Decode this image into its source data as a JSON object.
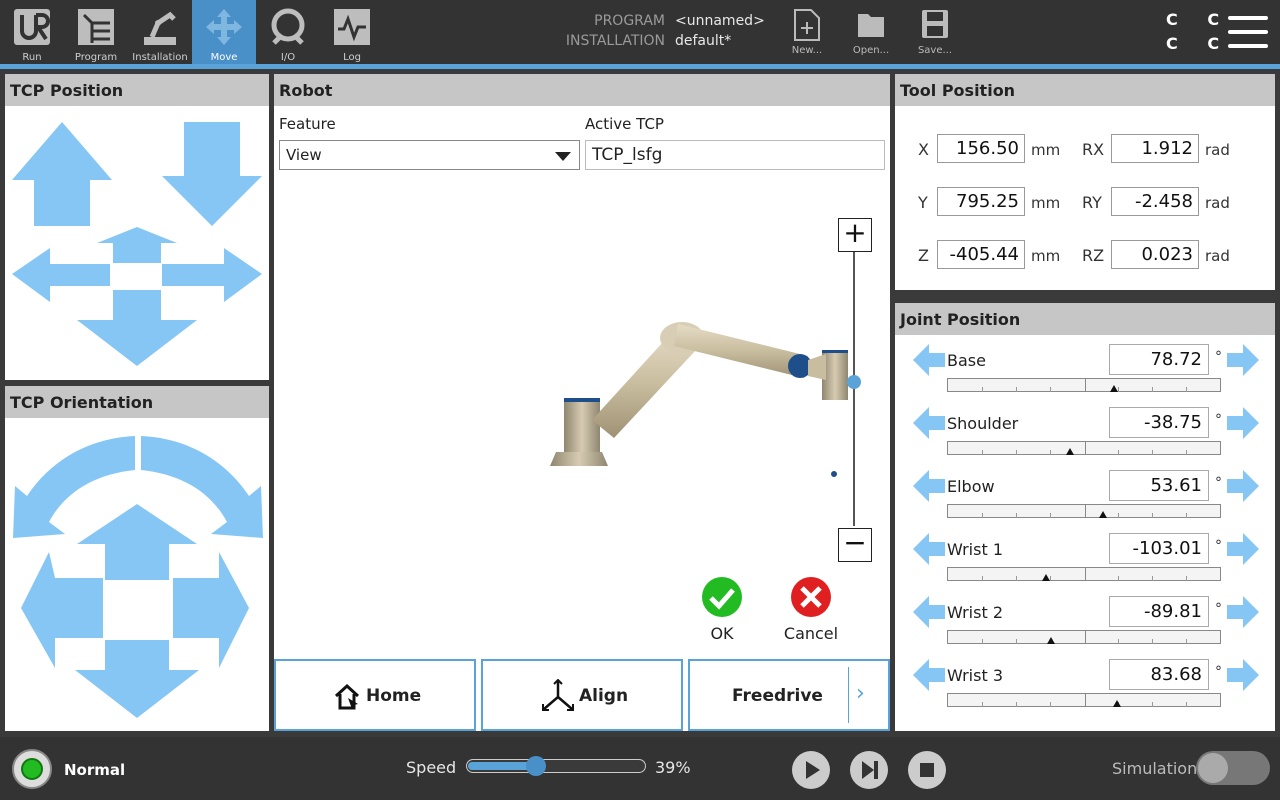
{
  "nav": [
    {
      "label": "Run",
      "icon": "ur-logo-icon"
    },
    {
      "label": "Program",
      "icon": "program-icon"
    },
    {
      "label": "Installation",
      "icon": "installation-icon"
    },
    {
      "label": "Move",
      "icon": "move-icon",
      "active": true
    },
    {
      "label": "I/O",
      "icon": "io-icon"
    },
    {
      "label": "Log",
      "icon": "log-icon"
    }
  ],
  "program": {
    "program_label": "PROGRAM",
    "program_value": "<unnamed>",
    "installation_label": "INSTALLATION",
    "installation_value": "default*"
  },
  "file_buttons": {
    "new": "New...",
    "open": "Open...",
    "save": "Save..."
  },
  "cc": {
    "row1": "C C",
    "row2": "C C"
  },
  "tcp_position": {
    "title": "TCP Position"
  },
  "tcp_orientation": {
    "title": "TCP Orientation"
  },
  "robot": {
    "title": "Robot",
    "feature_label": "Feature",
    "feature_value": "View",
    "active_tcp_label": "Active TCP",
    "active_tcp_value": "TCP_lsfg",
    "zoom_in": "+",
    "zoom_out": "−",
    "ok_label": "OK",
    "cancel_label": "Cancel",
    "home_label": "Home",
    "align_label": "Align",
    "freedrive_label": "Freedrive",
    "more_label": "›"
  },
  "tool_position": {
    "title": "Tool Position",
    "x": {
      "label": "X",
      "value": "156.50",
      "unit": "mm"
    },
    "y": {
      "label": "Y",
      "value": "795.25",
      "unit": "mm"
    },
    "z": {
      "label": "Z",
      "value": "-405.44",
      "unit": "mm"
    },
    "rx": {
      "label": "RX",
      "value": "1.912",
      "unit": "rad"
    },
    "ry": {
      "label": "RY",
      "value": "-2.458",
      "unit": "rad"
    },
    "rz": {
      "label": "RZ",
      "value": "0.023",
      "unit": "rad"
    }
  },
  "joint_position": {
    "title": "Joint Position",
    "unit": "°",
    "joints": [
      {
        "name": "Base",
        "value": "78.72",
        "fraction": 0.61
      },
      {
        "name": "Shoulder",
        "value": "-38.75",
        "fraction": 0.45
      },
      {
        "name": "Elbow",
        "value": "53.61",
        "fraction": 0.57
      },
      {
        "name": "Wrist 1",
        "value": "-103.01",
        "fraction": 0.36
      },
      {
        "name": "Wrist 2",
        "value": "-89.81",
        "fraction": 0.38
      },
      {
        "name": "Wrist 3",
        "value": "83.68",
        "fraction": 0.62
      }
    ]
  },
  "status": {
    "label": "Normal",
    "color": "#22bb22"
  },
  "speed": {
    "label": "Speed",
    "value": "39%",
    "fraction": 0.39
  },
  "simulation": {
    "label": "Simulation"
  },
  "colors": {
    "accent": "#5aa3d9",
    "arrow": "#85c6f5",
    "ok": "#22bb22",
    "cancel": "#e02020"
  }
}
